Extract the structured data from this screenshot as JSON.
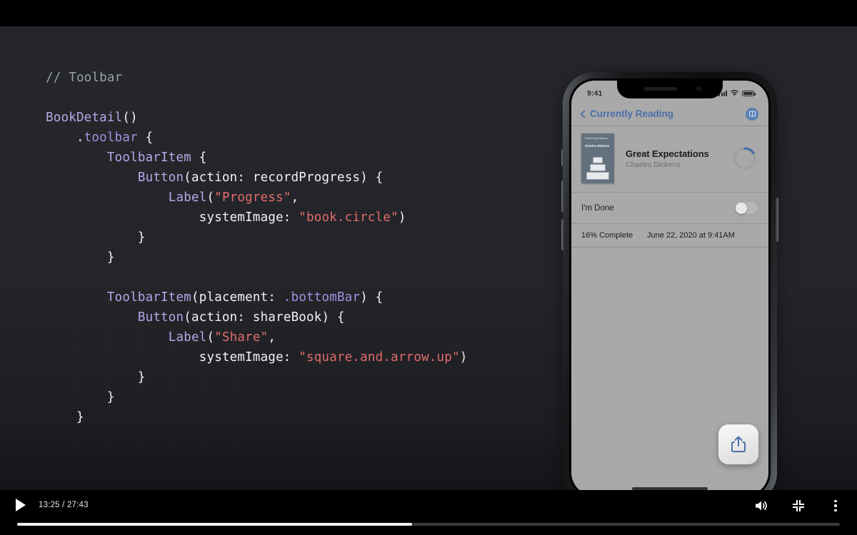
{
  "player": {
    "play_label": "play-button",
    "time_current": "13:25",
    "time_separator": " / ",
    "time_total": "27:43",
    "time_display": "13:25 / 27:43",
    "progress_percent": 48,
    "volume_icon": "volume-icon",
    "fullscreen_icon": "exit-fullscreen-icon",
    "more_icon": "more-options-icon"
  },
  "code": {
    "language": "swift",
    "lines": [
      {
        "id": "l1",
        "tokens": [
          {
            "t": "// Toolbar",
            "c": "cmt"
          }
        ]
      },
      {
        "id": "l2",
        "tokens": []
      },
      {
        "id": "l3",
        "tokens": [
          {
            "t": "BookDetail",
            "c": "typ"
          },
          {
            "t": "()",
            "c": "pln"
          }
        ]
      },
      {
        "id": "l4",
        "tokens": [
          {
            "t": "    .",
            "c": "pln"
          },
          {
            "t": "toolbar",
            "c": "prop"
          },
          {
            "t": " {",
            "c": "pln"
          }
        ]
      },
      {
        "id": "l5",
        "tokens": [
          {
            "t": "        ",
            "c": "pln"
          },
          {
            "t": "ToolbarItem",
            "c": "typ"
          },
          {
            "t": " {",
            "c": "pln"
          }
        ]
      },
      {
        "id": "l6",
        "tokens": [
          {
            "t": "            ",
            "c": "pln"
          },
          {
            "t": "Button",
            "c": "typ"
          },
          {
            "t": "(action: recordProgress) {",
            "c": "pln"
          }
        ]
      },
      {
        "id": "l7",
        "tokens": [
          {
            "t": "                ",
            "c": "pln"
          },
          {
            "t": "Label",
            "c": "typ"
          },
          {
            "t": "(",
            "c": "pln"
          },
          {
            "t": "\"Progress\"",
            "c": "str"
          },
          {
            "t": ",",
            "c": "pln"
          }
        ]
      },
      {
        "id": "l8",
        "tokens": [
          {
            "t": "                    systemImage: ",
            "c": "pln"
          },
          {
            "t": "\"book.circle\"",
            "c": "str"
          },
          {
            "t": ")",
            "c": "pln"
          }
        ]
      },
      {
        "id": "l9",
        "tokens": [
          {
            "t": "            }",
            "c": "pln"
          }
        ]
      },
      {
        "id": "l10",
        "tokens": [
          {
            "t": "        }",
            "c": "pln"
          }
        ]
      },
      {
        "id": "l11",
        "tokens": []
      },
      {
        "id": "l12",
        "tokens": [
          {
            "t": "        ",
            "c": "pln"
          },
          {
            "t": "ToolbarItem",
            "c": "typ"
          },
          {
            "t": "(placement: ",
            "c": "pln"
          },
          {
            "t": ".bottomBar",
            "c": "prop"
          },
          {
            "t": ") {",
            "c": "pln"
          }
        ]
      },
      {
        "id": "l13",
        "tokens": [
          {
            "t": "            ",
            "c": "pln"
          },
          {
            "t": "Button",
            "c": "typ"
          },
          {
            "t": "(action: shareBook) {",
            "c": "pln"
          }
        ]
      },
      {
        "id": "l14",
        "tokens": [
          {
            "t": "                ",
            "c": "pln"
          },
          {
            "t": "Label",
            "c": "typ"
          },
          {
            "t": "(",
            "c": "pln"
          },
          {
            "t": "\"Share\"",
            "c": "str"
          },
          {
            "t": ",",
            "c": "pln"
          }
        ]
      },
      {
        "id": "l15",
        "tokens": [
          {
            "t": "                    systemImage: ",
            "c": "pln"
          },
          {
            "t": "\"square.and.arrow.up\"",
            "c": "str"
          },
          {
            "t": ")",
            "c": "pln"
          }
        ]
      },
      {
        "id": "l16",
        "tokens": [
          {
            "t": "            }",
            "c": "pln"
          }
        ]
      },
      {
        "id": "l17",
        "tokens": [
          {
            "t": "        }",
            "c": "pln"
          }
        ]
      },
      {
        "id": "l18",
        "tokens": [
          {
            "t": "    }",
            "c": "pln"
          }
        ]
      }
    ]
  },
  "phone": {
    "status_bar": {
      "time": "9:41",
      "cellular": "signal-bars",
      "wifi": "wifi-icon",
      "battery": "battery-icon"
    },
    "nav_bar": {
      "back_label": "Currently Reading",
      "right_icon": "book-circle-icon"
    },
    "book": {
      "cover_title": "Great Expectations",
      "cover_author": "Charles Dickens",
      "title": "Great Expectations",
      "author": "Charles Dickens",
      "progress_percent": 16
    },
    "done_row": {
      "label": "I'm Done",
      "toggle_state": "off"
    },
    "stats_row": {
      "complete_label": "16% Complete",
      "timestamp": "June 22, 2020 at 9:41AM"
    },
    "share_button": {
      "icon": "share-icon"
    }
  },
  "colors": {
    "accent_blue": "#4a6fa8",
    "string_red": "#e06c6c",
    "type_purple": "#b9a6e8",
    "code_bg": "#25262b"
  }
}
